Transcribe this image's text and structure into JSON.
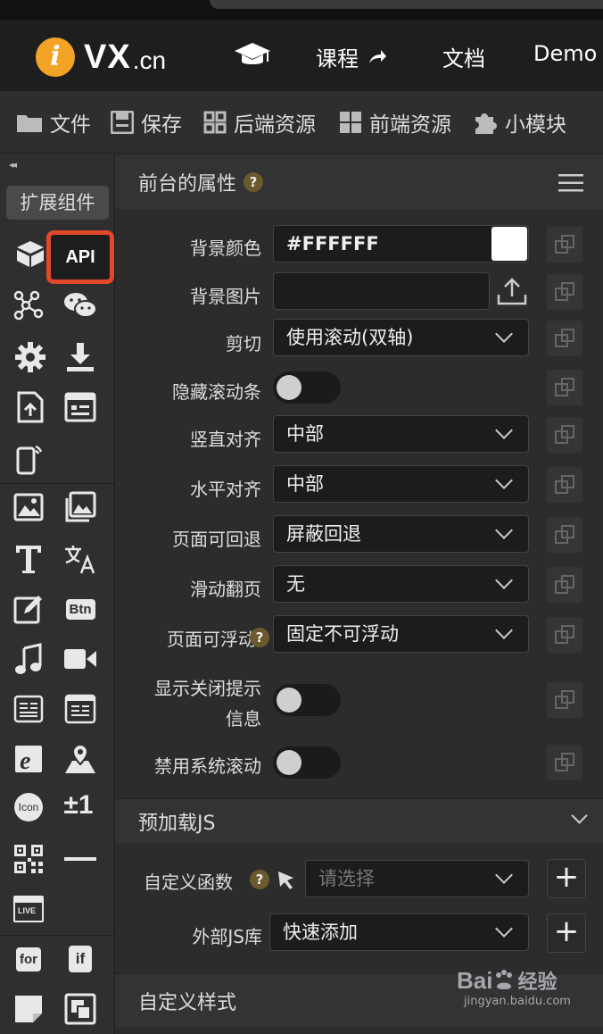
{
  "brand": {
    "logo_glyph": "i",
    "name": "VX",
    "tld": ".cn"
  },
  "nav": {
    "course": "课程",
    "docs": "文档",
    "demo": "Demo"
  },
  "toolbar": {
    "file": "文件",
    "save": "保存",
    "backend": "后端资源",
    "frontend": "前端资源",
    "module": "小模块"
  },
  "sidebar": {
    "collapse": "◂◂",
    "ext": "扩展组件",
    "api": "API",
    "btn": "Btn",
    "icon": "Icon",
    "plusminus": "±1",
    "live": "LIVE",
    "for": "for",
    "if": "if"
  },
  "panel": {
    "title": "前台的属性",
    "q": "?",
    "bg_color_label": "背景颜色",
    "bg_color_value": "#FFFFFF",
    "bg_image_label": "背景图片",
    "clip_label": "剪切",
    "clip_value": "使用滚动(双轴)",
    "hide_scroll_label": "隐藏滚动条",
    "valign_label": "竖直对齐",
    "valign_value": "中部",
    "halign_label": "水平对齐",
    "halign_value": "中部",
    "back_label": "页面可回退",
    "back_value": "屏蔽回退",
    "swipe_label": "滑动翻页",
    "swipe_value": "无",
    "float_label": "页面可浮动",
    "float_value": "固定不可浮动",
    "close_tip_label_1": "显示关闭提示",
    "close_tip_label_2": "信息",
    "disable_scroll_label": "禁用系统滚动"
  },
  "preload": {
    "title": "预加载JS",
    "func_label": "自定义函数",
    "func_placeholder": "请选择",
    "lib_label": "外部JS库",
    "lib_value": "快速添加"
  },
  "custom_style": {
    "title": "自定义样式"
  },
  "watermark": {
    "brand": "Bai",
    "brand2": "经验",
    "url": "jingyan.baidu.com"
  },
  "colors": {
    "accent_red": "#e04a2b",
    "logo_orange": "#f3a427"
  }
}
